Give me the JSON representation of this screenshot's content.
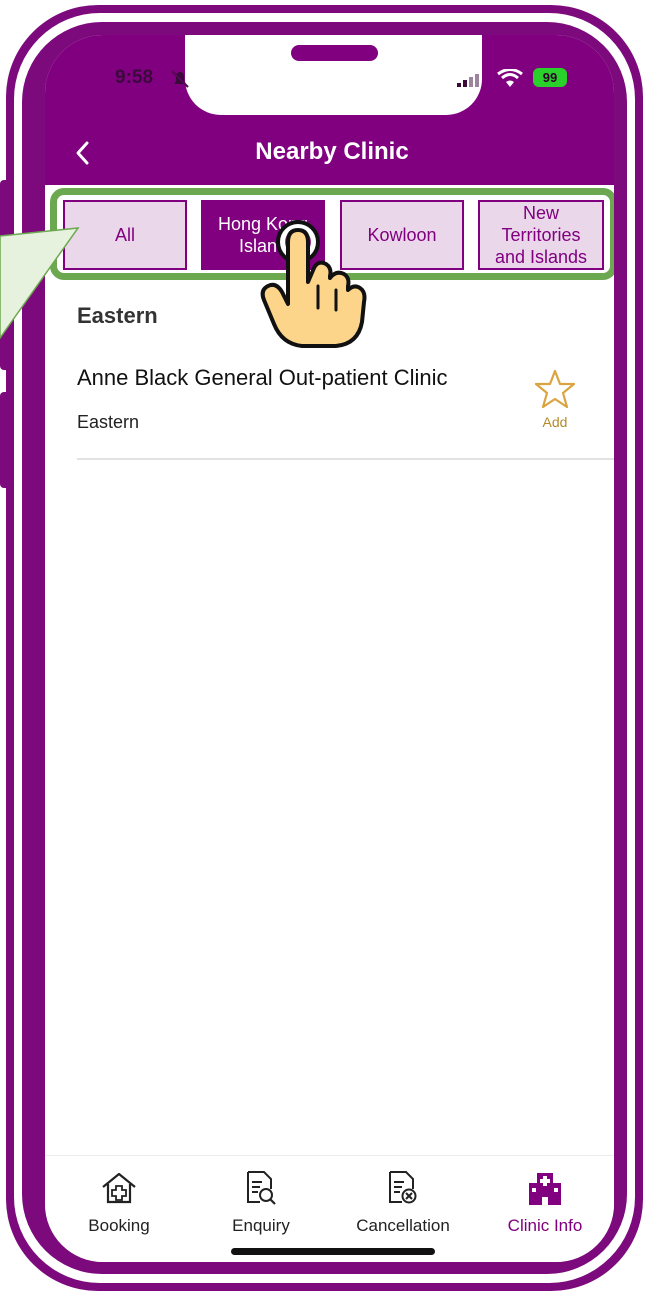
{
  "status_bar": {
    "time": "9:58",
    "battery": "99"
  },
  "header": {
    "title": "Nearby Clinic"
  },
  "tabs": [
    {
      "label": "All",
      "active": false
    },
    {
      "label": "Hong Kong Island",
      "active": true
    },
    {
      "label": "Kowloon",
      "active": false
    },
    {
      "label": "New Territories and Islands",
      "active": false
    }
  ],
  "list": {
    "section": "Eastern",
    "items": [
      {
        "name": "Anne Black General Out-patient Clinic",
        "district": "Eastern",
        "fav_label": "Add"
      }
    ]
  },
  "bottom_nav": [
    {
      "label": "Booking",
      "icon": "house-plus-icon"
    },
    {
      "label": "Enquiry",
      "icon": "document-search-icon"
    },
    {
      "label": "Cancellation",
      "icon": "document-cancel-icon"
    },
    {
      "label": "Clinic Info",
      "icon": "hospital-icon",
      "active": true
    }
  ],
  "colors": {
    "brand": "#800080",
    "highlight": "#6ba84f",
    "star": "#d9a441",
    "tab_inactive_bg": "#ead7ea"
  }
}
